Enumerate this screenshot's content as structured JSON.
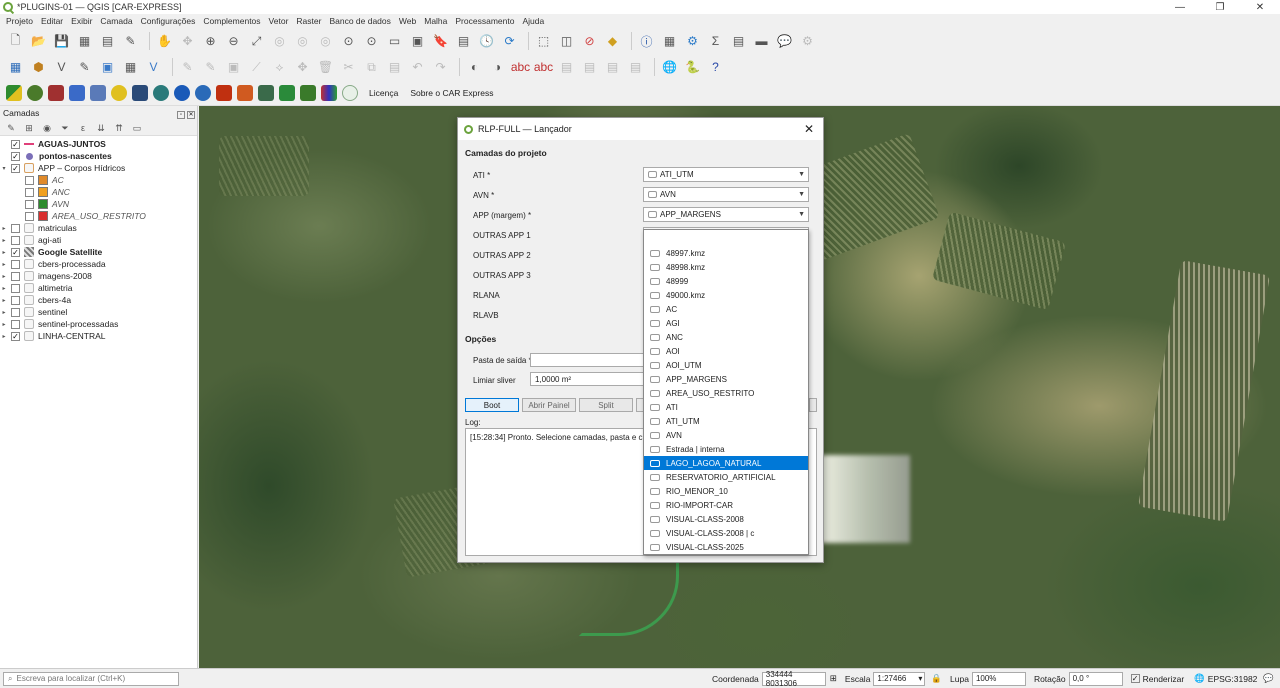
{
  "window": {
    "title": "*PLUGINS-01 — QGIS [CAR-EXPRESS]",
    "minimize": "—",
    "maximize": "❐",
    "close": "✕"
  },
  "menu": [
    "Projeto",
    "Editar",
    "Exibir",
    "Camada",
    "Configurações",
    "Complementos",
    "Vetor",
    "Raster",
    "Banco de dados",
    "Web",
    "Malha",
    "Processamento",
    "Ajuda"
  ],
  "toolbar3": {
    "license": "Licença",
    "about": "Sobre o CAR Express"
  },
  "layers_panel": {
    "title": "Camadas",
    "layers": [
      {
        "label": "AGUAS-JUNTOS",
        "checked": true,
        "bold": true,
        "arrow": "",
        "symbol": "line",
        "color": "#e0407a"
      },
      {
        "label": "pontos-nascentes",
        "checked": true,
        "bold": true,
        "arrow": "",
        "symbol": "point",
        "color": "#7b6fb8"
      },
      {
        "label": "APP – Corpos Hídricos",
        "checked": true,
        "bold": false,
        "arrow": "▾",
        "symbol": "group",
        "color": "#d8a060"
      },
      {
        "label": "AC",
        "checked": false,
        "child": true,
        "italic": true,
        "symbol": "fill",
        "color": "#e08a2a"
      },
      {
        "label": "ANC",
        "checked": false,
        "child": true,
        "italic": true,
        "symbol": "fill",
        "color": "#f0a020"
      },
      {
        "label": "AVN",
        "checked": false,
        "child": true,
        "italic": true,
        "symbol": "fill",
        "color": "#2e8b2e"
      },
      {
        "label": "AREA_USO_RESTRITO",
        "checked": false,
        "child": true,
        "italic": true,
        "symbol": "fill",
        "color": "#d83030"
      },
      {
        "label": "matriculas",
        "checked": false,
        "arrow": "▸",
        "symbol": "group",
        "color": "#bbb"
      },
      {
        "label": "agi-ati",
        "checked": false,
        "arrow": "▸",
        "symbol": "group",
        "color": "#bbb"
      },
      {
        "label": "Google Satellite",
        "checked": true,
        "bold": true,
        "arrow": "▸",
        "symbol": "raster",
        "color": "#555"
      },
      {
        "label": "cbers-processada",
        "checked": false,
        "arrow": "▸",
        "symbol": "group",
        "color": "#bbb"
      },
      {
        "label": "imagens-2008",
        "checked": false,
        "arrow": "▸",
        "symbol": "group",
        "color": "#bbb"
      },
      {
        "label": "altimetria",
        "checked": false,
        "arrow": "▸",
        "symbol": "group",
        "color": "#bbb"
      },
      {
        "label": "cbers-4a",
        "checked": false,
        "arrow": "▸",
        "symbol": "group",
        "color": "#bbb"
      },
      {
        "label": "sentinel",
        "checked": false,
        "arrow": "▸",
        "symbol": "group",
        "color": "#bbb"
      },
      {
        "label": "sentinel-processadas",
        "checked": false,
        "arrow": "▸",
        "symbol": "group",
        "color": "#bbb"
      },
      {
        "label": "LINHA-CENTRAL",
        "checked": true,
        "arrow": "▸",
        "symbol": "group",
        "color": "#bbb"
      }
    ]
  },
  "dialog": {
    "title": "RLP-FULL — Lançador",
    "group_layers": "Camadas do projeto",
    "fields": [
      {
        "label": "ATI *",
        "value": "ATI_UTM"
      },
      {
        "label": "AVN *",
        "value": "AVN"
      },
      {
        "label": "APP (margem) *",
        "value": "APP_MARGENS"
      },
      {
        "label": "OUTRAS APP 1",
        "value": ""
      },
      {
        "label": "OUTRAS APP 2",
        "value": ""
      },
      {
        "label": "OUTRAS APP 3",
        "value": ""
      },
      {
        "label": "RLANA",
        "value": ""
      },
      {
        "label": "RLAVB",
        "value": ""
      }
    ],
    "group_options": "Opções",
    "output_label": "Pasta de saída *",
    "output_value": "",
    "sliver_label": "Limiar sliver",
    "sliver_value": "1,0000 m²",
    "buttons": {
      "boot": "Boot",
      "open_panel": "Abrir Painel",
      "split": "Split"
    },
    "log_label": "Log:",
    "log_text": "[15:28:34] Pronto. Selecione camadas, pasta e clique B"
  },
  "dropdown": {
    "items": [
      "48997.kmz",
      "48998.kmz",
      "48999",
      "49000.kmz",
      "AC",
      "AGI",
      "ANC",
      "AOI",
      "AOI_UTM",
      "APP_MARGENS",
      "AREA_USO_RESTRITO",
      "ATI",
      "ATI_UTM",
      "AVN",
      "Estrada | interna",
      "LAGO_LAGOA_NATURAL",
      "RESERVATORIO_ARTIFICIAL",
      "RIO_MENOR_10",
      "RIO-IMPORT-CAR",
      "VISUAL-CLASS-2008",
      "VISUAL-CLASS-2008 | c",
      "VISUAL-CLASS-2025"
    ],
    "selected": "LAGO_LAGOA_NATURAL"
  },
  "statusbar": {
    "locator_placeholder": "Escreva para localizar (Ctrl+K)",
    "coord_label": "Coordenada",
    "coord_value": "334444  8031306",
    "scale_label": "Escala",
    "scale_value": "1:27466",
    "magnifier_label": "Lupa",
    "magnifier_value": "100%",
    "rotation_label": "Rotação",
    "rotation_value": "0,0 °",
    "render_label": "Renderizar",
    "crs": "EPSG:31982"
  },
  "colors": {
    "accent": "#0078d7",
    "qgis_green": "#6ba33d"
  }
}
